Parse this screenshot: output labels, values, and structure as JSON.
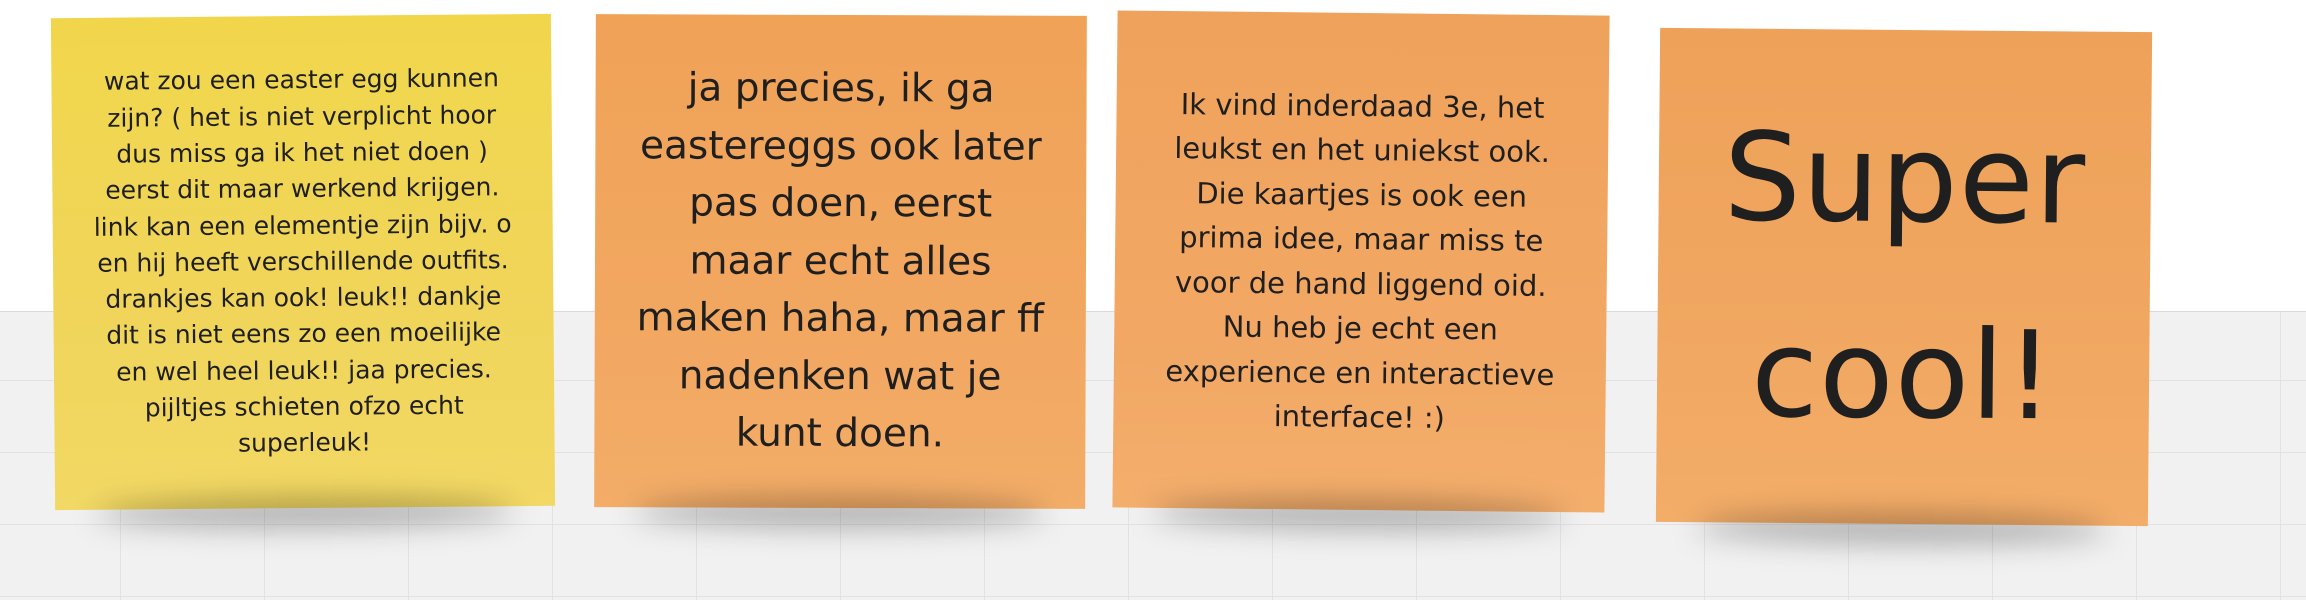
{
  "board": {
    "notes": [
      {
        "color": "#f1d64c",
        "text": "wat zou een easter egg kunnen\nzijn? ( het is niet verplicht hoor\ndus miss ga ik het niet doen )\neerst dit maar werkend krijgen.\nlink kan een elementje zijn bijv. o\nen hij heeft verschillende outfits.\ndrankjes kan ook! leuk!! dankje\ndit is niet eens zo een moeilijke\nen wel heel leuk!! jaa precies.\npijltjes schieten ofzo echt\nsuperleuk!"
      },
      {
        "color": "#f0a257",
        "text": "ja precies, ik ga\neastereggs ook later\npas doen, eerst\nmaar echt alles\nmaken haha, maar ff\nnadenken wat je\nkunt doen."
      },
      {
        "color": "#efa25b",
        "text": "Ik vind inderdaad 3e, het\nleukst en het uniekst ook.\nDie kaartjes is ook een\nprima idee, maar miss te\nvoor de hand liggend oid.\nNu heb je echt een\nexperience en interactieve\ninterface! :)"
      },
      {
        "color": "#eea159",
        "text": "Super\ncool!"
      }
    ]
  }
}
